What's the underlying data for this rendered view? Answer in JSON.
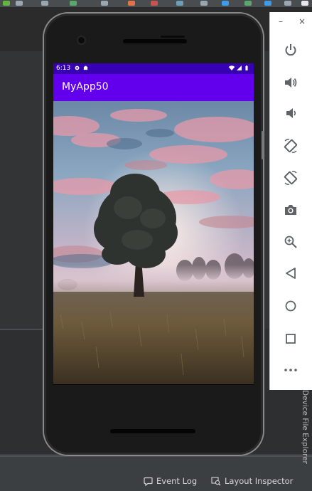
{
  "ide": {
    "statusbar": {
      "event_log_label": "Event Log",
      "layout_inspector_label": "Layout Inspector"
    },
    "side_tab_label": "Device File Explorer"
  },
  "device": {
    "status_bar": {
      "time": "6:13",
      "icons": [
        "settings-icon",
        "battery-saver-icon",
        "wifi-icon",
        "signal-icon",
        "battery-icon"
      ]
    },
    "app_bar": {
      "title": "MyApp50"
    },
    "content_image": {
      "subject": "tree-in-field-at-sunset-photo"
    },
    "nav_bar": {
      "buttons": [
        "back",
        "home",
        "overview"
      ]
    }
  },
  "emulator_controls": {
    "window_buttons": [
      "minimize",
      "close"
    ],
    "window_minimize_glyph": "–",
    "window_close_glyph": "×",
    "buttons": [
      "power",
      "volume-up",
      "volume-down",
      "rotate-left",
      "rotate-right",
      "screenshot",
      "zoom",
      "back",
      "home",
      "overview",
      "more"
    ]
  },
  "colors": {
    "app_bar": "#6200ee",
    "status_bar": "#3700b3",
    "ide_background": "#3c3f41",
    "control_icon": "#5f6368"
  }
}
